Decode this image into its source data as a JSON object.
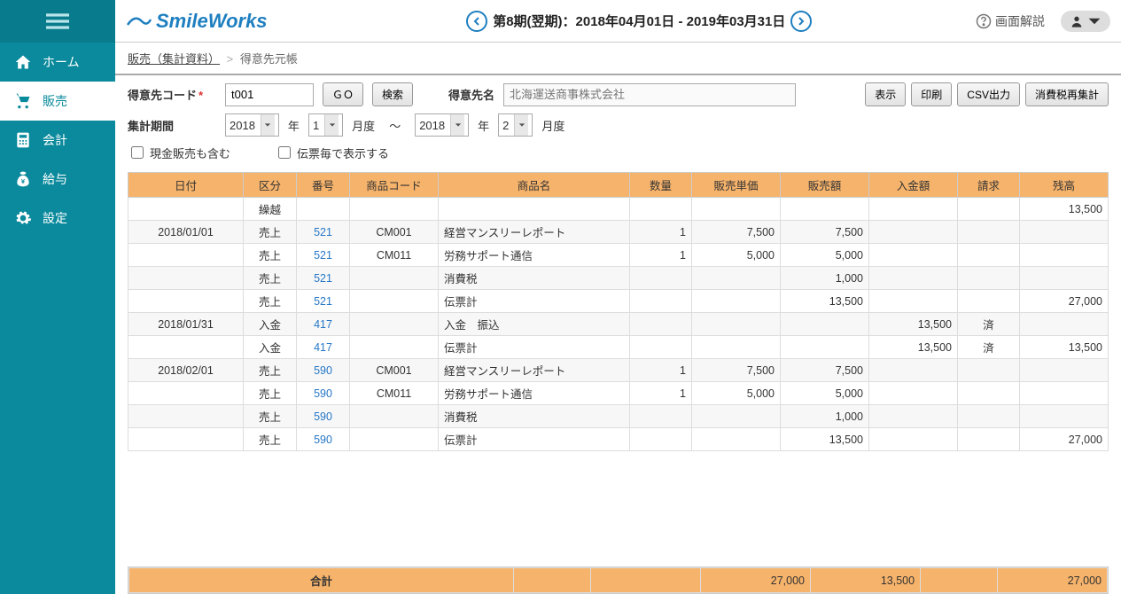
{
  "sidebar": {
    "items": [
      {
        "label": "ホーム"
      },
      {
        "label": "販売"
      },
      {
        "label": "会計"
      },
      {
        "label": "給与"
      },
      {
        "label": "設定"
      }
    ]
  },
  "brand": "SmileWorks",
  "period": "第8期(翌期)：2018年04月01日 - 2019年03月31日",
  "help_label": "画面解説",
  "breadcrumb": {
    "parent": "販売（集計資料）",
    "current": "得意先元帳"
  },
  "filters": {
    "code_label": "得意先コード",
    "code_value": "t001",
    "go_label": "ＧＯ",
    "search_label": "検索",
    "name_label": "得意先名",
    "name_placeholder": "北海運送商事株式会社",
    "period_label": "集計期間",
    "year1": "2018",
    "year_unit": "年",
    "month1": "1",
    "month_unit": "月度",
    "range_sep": "〜",
    "year2": "2018",
    "month2": "2",
    "cash_label": "現金販売も含む",
    "perslip_label": "伝票毎で表示する"
  },
  "actions": {
    "display": "表示",
    "print": "印刷",
    "csv": "CSV出力",
    "tax": "消費税再集計"
  },
  "columns": {
    "date": "日付",
    "type": "区分",
    "no": "番号",
    "pcode": "商品コード",
    "pname": "商品名",
    "qty": "数量",
    "unit": "販売単価",
    "sales": "販売額",
    "deposit": "入金額",
    "bill": "請求",
    "balance": "残高"
  },
  "rows": [
    {
      "date": "",
      "type": "繰越",
      "no": "",
      "pcode": "",
      "pname": "",
      "qty": "",
      "unit": "",
      "sales": "",
      "deposit": "",
      "bill": "",
      "balance": "13,500"
    },
    {
      "date": "2018/01/01",
      "type": "売上",
      "no": "521",
      "pcode": "CM001",
      "pname": "経営マンスリーレポート",
      "qty": "1",
      "unit": "7,500",
      "sales": "7,500",
      "deposit": "",
      "bill": "",
      "balance": ""
    },
    {
      "date": "",
      "type": "売上",
      "no": "521",
      "pcode": "CM011",
      "pname": "労務サポート通信",
      "qty": "1",
      "unit": "5,000",
      "sales": "5,000",
      "deposit": "",
      "bill": "",
      "balance": ""
    },
    {
      "date": "",
      "type": "売上",
      "no": "521",
      "pcode": "",
      "pname": "消費税",
      "qty": "",
      "unit": "",
      "sales": "1,000",
      "deposit": "",
      "bill": "",
      "balance": ""
    },
    {
      "date": "",
      "type": "売上",
      "no": "521",
      "pcode": "",
      "pname": "伝票計",
      "qty": "",
      "unit": "",
      "sales": "13,500",
      "deposit": "",
      "bill": "",
      "balance": "27,000"
    },
    {
      "date": "2018/01/31",
      "type": "入金",
      "no": "417",
      "pcode": "",
      "pname": "入金　振込",
      "qty": "",
      "unit": "",
      "sales": "",
      "deposit": "13,500",
      "bill": "済",
      "balance": ""
    },
    {
      "date": "",
      "type": "入金",
      "no": "417",
      "pcode": "",
      "pname": "伝票計",
      "qty": "",
      "unit": "",
      "sales": "",
      "deposit": "13,500",
      "bill": "済",
      "balance": "13,500"
    },
    {
      "date": "2018/02/01",
      "type": "売上",
      "no": "590",
      "pcode": "CM001",
      "pname": "経営マンスリーレポート",
      "qty": "1",
      "unit": "7,500",
      "sales": "7,500",
      "deposit": "",
      "bill": "",
      "balance": ""
    },
    {
      "date": "",
      "type": "売上",
      "no": "590",
      "pcode": "CM011",
      "pname": "労務サポート通信",
      "qty": "1",
      "unit": "5,000",
      "sales": "5,000",
      "deposit": "",
      "bill": "",
      "balance": ""
    },
    {
      "date": "",
      "type": "売上",
      "no": "590",
      "pcode": "",
      "pname": "消費税",
      "qty": "",
      "unit": "",
      "sales": "1,000",
      "deposit": "",
      "bill": "",
      "balance": ""
    },
    {
      "date": "",
      "type": "売上",
      "no": "590",
      "pcode": "",
      "pname": "伝票計",
      "qty": "",
      "unit": "",
      "sales": "13,500",
      "deposit": "",
      "bill": "",
      "balance": "27,000"
    }
  ],
  "footer": {
    "label": "合計",
    "sales": "27,000",
    "deposit": "13,500",
    "balance": "27,000"
  }
}
